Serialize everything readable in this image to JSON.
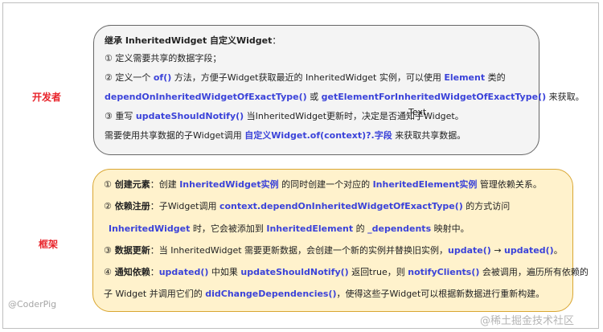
{
  "labels": {
    "developer": "开发者",
    "framework": "框架"
  },
  "dev": {
    "l1": {
      "a": "继承 InheritedWidget 自定义Widget",
      "b": "："
    },
    "l2": "① 定义需要共享的数据字段；",
    "l3": {
      "a": "② 定义一个 ",
      "b": "of()",
      "c": " 方法，方便子Widget获取最近的 InheritedWidget 实例，可以使用 ",
      "d": "Element",
      "e": " 类的"
    },
    "l4": {
      "a": "dependOnInheritedWidgetOfExactType()",
      "b": " 或 ",
      "c": "getElementForInheritedWidgetOfExactType()",
      "d": " 来获取。"
    },
    "l5": {
      "a": "③ 重写 ",
      "b": "updateShouldNotify()",
      "c": " 当InheritedWidget更新时，决定是否通知子Widget。"
    },
    "l6": {
      "a": "需要使用共享数据的子Widget调用 ",
      "b": "自定义Widget.of(context)?.字段",
      "c": " 来获取共享数据。"
    }
  },
  "floating_text": "Text",
  "fw": {
    "l1": {
      "n": "①",
      "a": " 创建元素",
      "b": "：创建 ",
      "c": "InheritedWidget实例",
      "d": " 的同时创建一个对应的 ",
      "e": "InheritedElement实例",
      "f": " 管理依赖关系。"
    },
    "l2": {
      "n": "②",
      "a": " 依赖注册",
      "b": "：子Widget调用 ",
      "c": "context.dependOnInheritedWidgetOfExactType()",
      "d": " 的方式访问"
    },
    "l3": {
      "a": "InheritedWidget",
      "b": " 时，它会被添加到 ",
      "c": "InheritedElement",
      "d": " 的 ",
      "e": "_dependents",
      "f": " 映射中。"
    },
    "l4": {
      "n": "③",
      "a": " 数据更新",
      "b": "：当  InheritedWidget 需要更新数据，会创建一个新的实例并替换旧实例，",
      "c": "update()",
      "d": " → ",
      "e": "updated()",
      "f": "。"
    },
    "l5": {
      "n": "④",
      "a": " 通知依赖",
      "b": "：",
      "c": "updated()",
      "d": " 中如果 ",
      "e": "updateShouldNotify()",
      "f": " 返回true，则 ",
      "g": "notifyClients()",
      "h": " 会被调用，遍历所有依赖的"
    },
    "l6": {
      "a": "子 Widget 并调用它们的 ",
      "b": "didChangeDependencies()",
      "c": "，使得这些子Widget可以根据新数据进行重新构建。"
    }
  },
  "watermarks": {
    "left": "@CoderPig",
    "right": "@稀土掘金技术社区"
  }
}
